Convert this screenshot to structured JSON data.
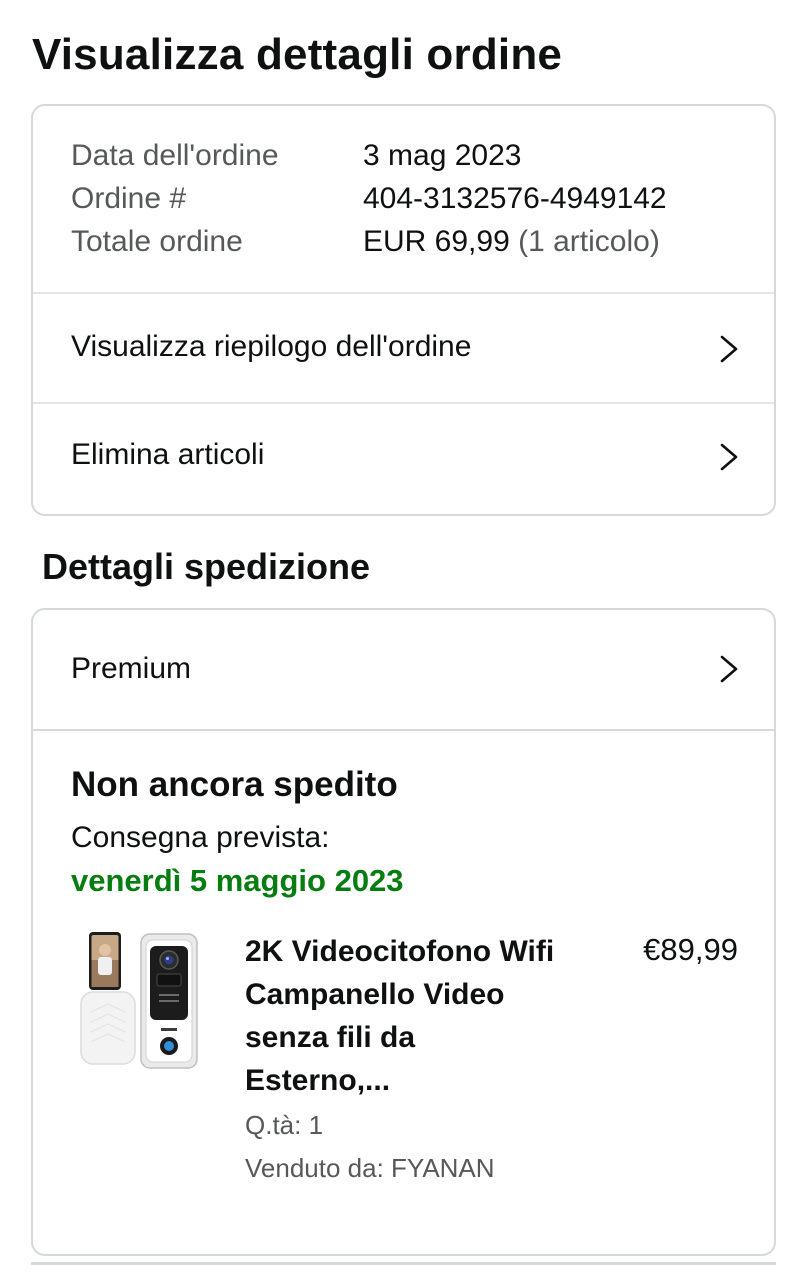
{
  "page": {
    "title": "Visualizza dettagli ordine"
  },
  "order_summary": {
    "date_label": "Data dell'ordine",
    "date_value": "3 mag 2023",
    "number_label": "Ordine #",
    "number_value": "404-3132576-4949142",
    "total_label": "Totale ordine",
    "total_value": "EUR 69,99",
    "total_items": "(1 articolo)"
  },
  "order_actions": {
    "view_summary_label": "Visualizza riepilogo dell'ordine",
    "remove_items_label": "Elimina articoli"
  },
  "shipping": {
    "section_title": "Dettagli spedizione",
    "speed_label": "Premium",
    "status": "Non ancora spedito",
    "delivery_label": "Consegna prevista:",
    "delivery_date": "venerdì 5 maggio 2023",
    "colors": {
      "delivery_date": "#067d10"
    }
  },
  "product": {
    "title": "2K Videocitofono Wifi Campanello Video senza fili da Esterno,...",
    "price": "€89,99",
    "quantity": "Q.tà: 1",
    "seller": "Venduto da: FYANAN",
    "image_icon": "video-doorbell-product-image"
  },
  "icons": {
    "chevron": "chevron-right-icon"
  }
}
